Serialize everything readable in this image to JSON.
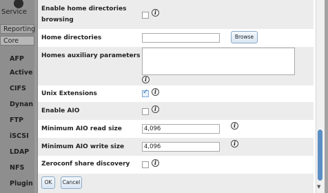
{
  "background": {
    "title": "Service",
    "tabs": [
      "Reporting",
      "Core"
    ],
    "items": [
      "AFP",
      "Active",
      "CIFS",
      "Dynan",
      "FTP",
      "iSCSI",
      "LDAP",
      "NFS",
      "Plugin"
    ]
  },
  "form": {
    "enable_home_dir_browsing": {
      "label_line1": "Enable home directories",
      "label_line2": "browsing",
      "checked": false
    },
    "home_directories": {
      "label": "Home directories",
      "value": "",
      "browse_label": "Browse"
    },
    "homes_aux_params": {
      "label": "Homes auxiliary parameters",
      "value": ""
    },
    "unix_extensions": {
      "label": "Unix Extensions",
      "checked": true
    },
    "enable_aio": {
      "label": "Enable AIO",
      "checked": false
    },
    "min_aio_read_size": {
      "label": "Minimum AIO read size",
      "value": "4,096"
    },
    "min_aio_write_size": {
      "label": "Minimum AIO write size",
      "value": "4,096"
    },
    "zeroconf_share_discovery": {
      "label": "Zeroconf share discovery",
      "checked": false
    }
  },
  "info_glyph": "i",
  "buttons": {
    "ok": "OK",
    "cancel": "Cancel"
  },
  "colors": {
    "accent": "#5b8fc4",
    "row_shade": "#ececec"
  }
}
